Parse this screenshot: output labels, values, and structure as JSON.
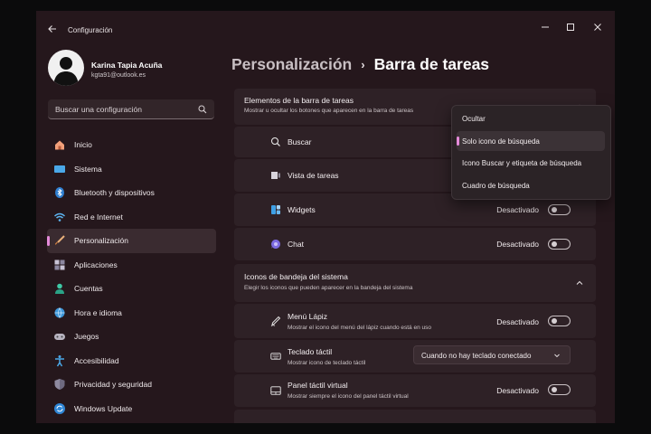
{
  "window": {
    "title": "Configuración"
  },
  "user": {
    "name": "Karina Tapia Acuña",
    "email": "kgta91@outlook.es"
  },
  "search": {
    "placeholder": "Buscar una configuración"
  },
  "nav": [
    {
      "label": "Inicio",
      "icon": "home-icon"
    },
    {
      "label": "Sistema",
      "icon": "system-icon"
    },
    {
      "label": "Bluetooth y dispositivos",
      "icon": "bluetooth-icon"
    },
    {
      "label": "Red e Internet",
      "icon": "wifi-icon"
    },
    {
      "label": "Personalización",
      "icon": "brush-icon",
      "active": true
    },
    {
      "label": "Aplicaciones",
      "icon": "apps-icon"
    },
    {
      "label": "Cuentas",
      "icon": "account-icon"
    },
    {
      "label": "Hora e idioma",
      "icon": "globe-icon"
    },
    {
      "label": "Juegos",
      "icon": "gamepad-icon"
    },
    {
      "label": "Accesibilidad",
      "icon": "accessibility-icon"
    },
    {
      "label": "Privacidad y seguridad",
      "icon": "shield-icon"
    },
    {
      "label": "Windows Update",
      "icon": "update-icon"
    }
  ],
  "breadcrumb": {
    "parent": "Personalización",
    "separator": "›",
    "current": "Barra de tareas"
  },
  "taskbar_items": {
    "title": "Elementos de la barra de tareas",
    "subtitle": "Mostrar u ocultar los botones que aparecen en la barra de tareas",
    "rows": [
      {
        "label": "Buscar",
        "icon": "search-icon"
      },
      {
        "label": "Vista de tareas",
        "icon": "task-view-icon"
      },
      {
        "label": "Widgets",
        "icon": "widgets-icon",
        "state": "Desactivado"
      },
      {
        "label": "Chat",
        "icon": "chat-icon",
        "state": "Desactivado"
      }
    ]
  },
  "tray_icons": {
    "title": "Iconos de bandeja del sistema",
    "subtitle": "Elegir los iconos que pueden aparecer en la bandeja del sistema",
    "rows": [
      {
        "label": "Menú Lápiz",
        "sub": "Mostrar el icono del menú del lápiz cuando está en uso",
        "icon": "pen-icon",
        "state": "Desactivado"
      },
      {
        "label": "Teclado táctil",
        "sub": "Mostrar icono de teclado táctil",
        "icon": "keyboard-icon",
        "select": "Cuando no hay teclado conectado"
      },
      {
        "label": "Panel táctil virtual",
        "sub": "Mostrar siempre el icono del panel táctil virtual",
        "icon": "touchpad-icon",
        "state": "Desactivado"
      }
    ]
  },
  "search_dropdown": {
    "options": [
      "Ocultar",
      "Solo icono de búsqueda",
      "Icono Buscar y etiqueta de búsqueda",
      "Cuadro de búsqueda"
    ],
    "selected_index": 1
  },
  "colors": {
    "accent": "#e58ad9",
    "window_bg": "#25171c",
    "card_bg": "#2e2126"
  }
}
